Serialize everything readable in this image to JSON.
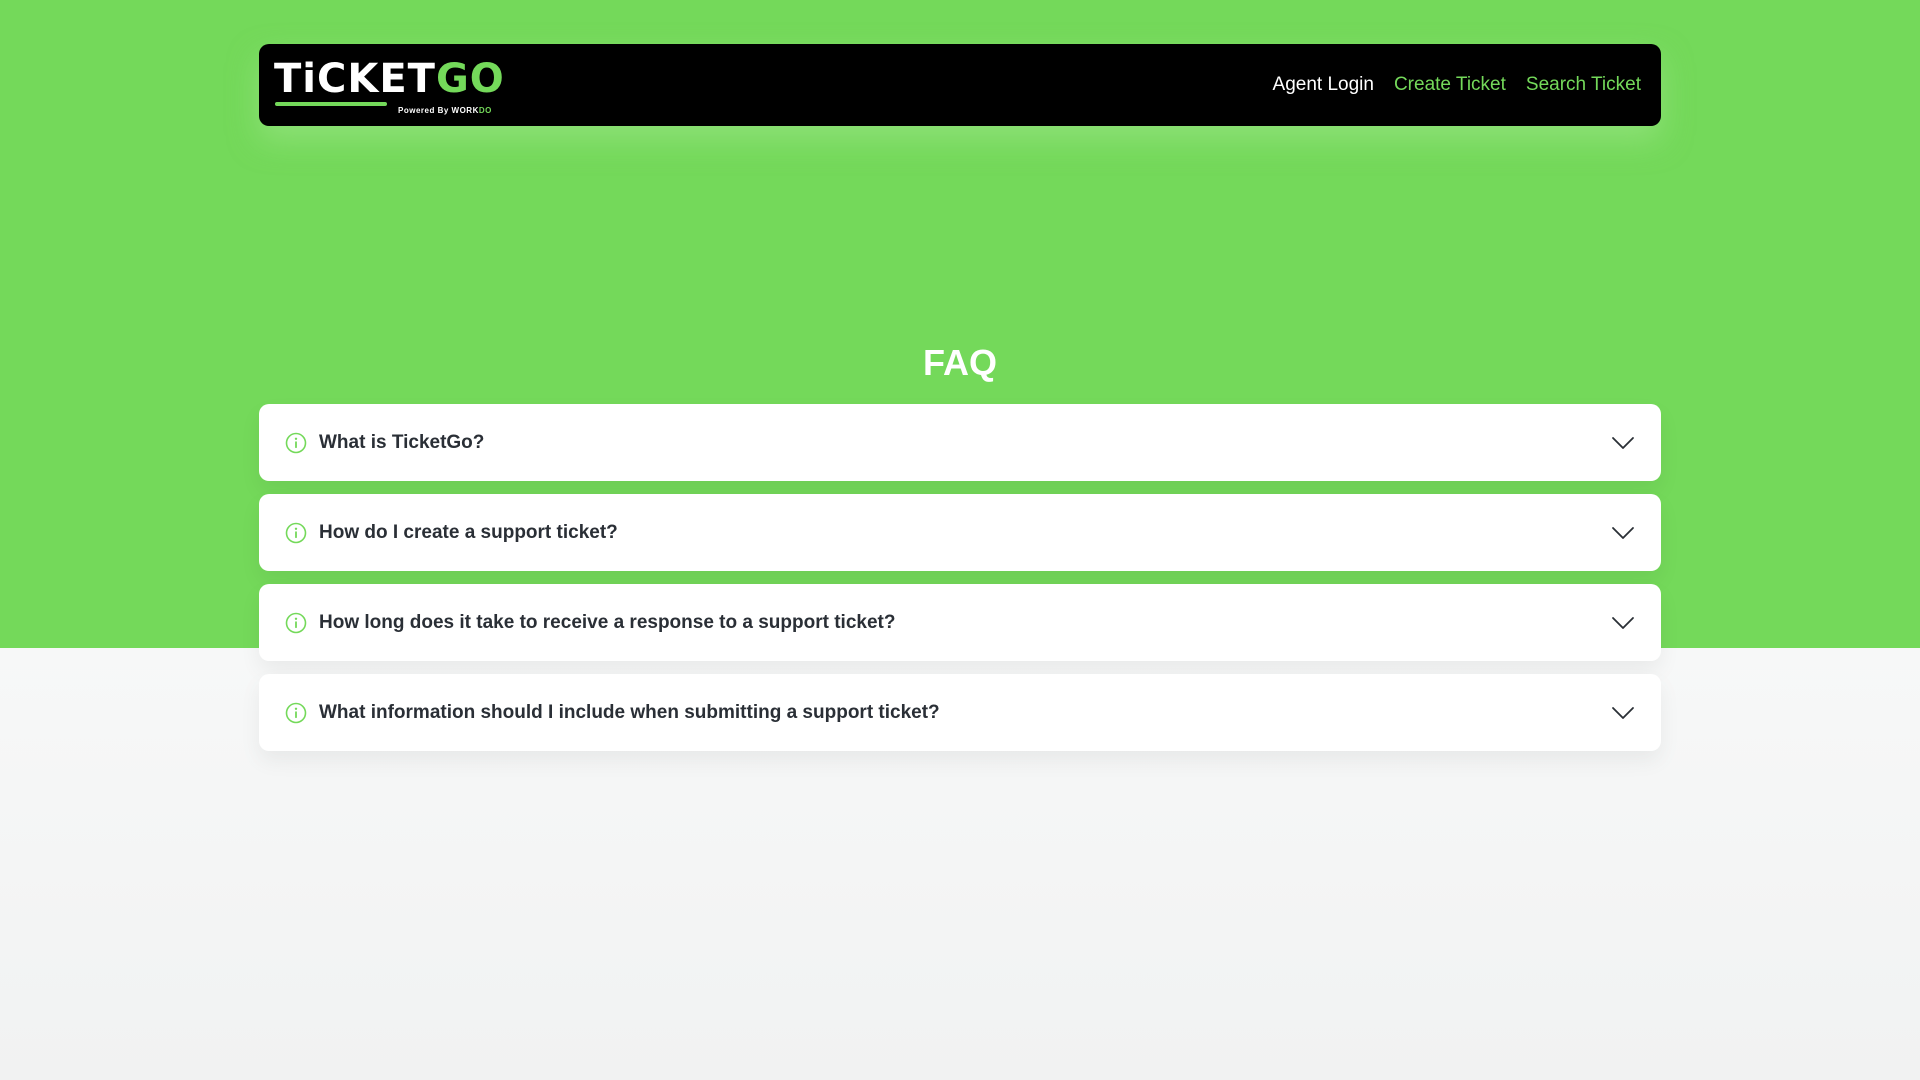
{
  "colors": {
    "accent": "#74d95a",
    "navbar_bg": "#000000",
    "page_bottom_bg": "#f5f6f6",
    "question_text": "#2a2f36"
  },
  "header": {
    "logo": {
      "word_white": "TiCKET",
      "word_green": "GO",
      "powered_prefix": "Powered By ",
      "powered_brand_white": "WORK",
      "powered_brand_green": "DO"
    },
    "nav": [
      {
        "label": "Agent Login",
        "color": "white"
      },
      {
        "label": "Create Ticket",
        "color": "green"
      },
      {
        "label": "Search Ticket",
        "color": "green"
      }
    ]
  },
  "faq": {
    "title": "FAQ",
    "items": [
      {
        "question": "What is TicketGo?",
        "icon": "info-icon",
        "toggle_icon": "chevron-down-icon"
      },
      {
        "question": "How do I create a support ticket?",
        "icon": "info-icon",
        "toggle_icon": "chevron-down-icon"
      },
      {
        "question": "How long does it take to receive a response to a support ticket?",
        "icon": "info-icon",
        "toggle_icon": "chevron-down-icon"
      },
      {
        "question": "What information should I include when submitting a support ticket?",
        "icon": "info-icon",
        "toggle_icon": "chevron-down-icon"
      }
    ]
  }
}
